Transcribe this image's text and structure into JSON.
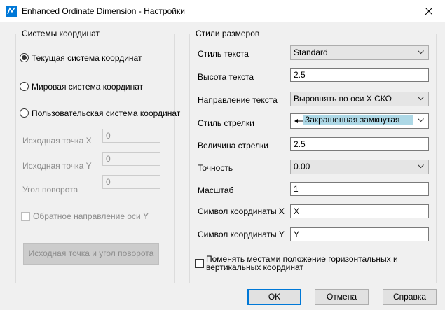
{
  "window": {
    "title": "Enhanced Ordinate Dimension - Настройки"
  },
  "coords": {
    "legend": "Системы координат",
    "radio_current": "Текущая система координат",
    "radio_world": "Мировая система координат",
    "radio_user": "Пользовательская система координат",
    "origin_x_label": "Исходная точка X",
    "origin_x_value": "0",
    "origin_y_label": "Исходная точка Y",
    "origin_y_value": "0",
    "rotation_label": "Угол поворота",
    "rotation_value": "0",
    "reverse_y_label": "Обратное направление оси Y",
    "pick_button": "Исходная точка и угол поворота"
  },
  "styles": {
    "legend": "Стили размеров",
    "text_style_label": "Стиль текста",
    "text_style_value": "Standard",
    "text_height_label": "Высота текста",
    "text_height_value": "2.5",
    "text_dir_label": "Направление текста",
    "text_dir_value": "Выровнять по оси X СКО",
    "arrow_style_label": "Стиль стрелки",
    "arrow_style_value": "Закрашенная замкнутая",
    "arrow_size_label": "Величина стрелки",
    "arrow_size_value": "2.5",
    "precision_label": "Точность",
    "precision_value": "0.00",
    "scale_label": "Масштаб",
    "scale_value": "1",
    "sym_x_label": "Символ координаты X",
    "sym_x_value": "X",
    "sym_y_label": "Символ координаты Y",
    "sym_y_value": "Y",
    "swap_label_line1": "Поменять местами положение горизонтальных и",
    "swap_label_line2": "вертикальных координат"
  },
  "buttons": {
    "ok": "OK",
    "cancel": "Отмена",
    "help": "Справка"
  },
  "icons": {
    "app": "dimension-app-icon",
    "close": "close-icon",
    "chevron": "chevron-down-icon",
    "arrow": "filled-arrow-icon"
  },
  "colors": {
    "accent": "#0078d7",
    "selection": "#add8e6",
    "app_icon": "#0078d7"
  }
}
